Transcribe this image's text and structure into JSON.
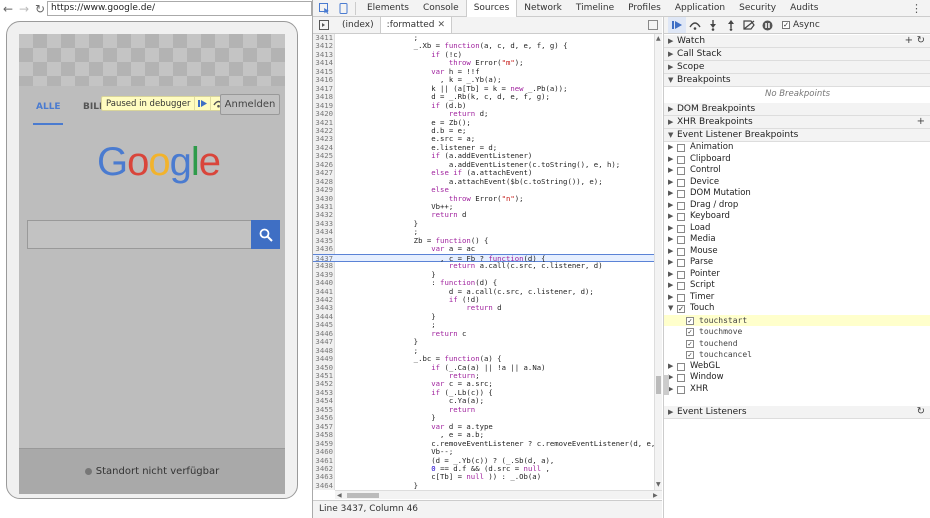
{
  "browser": {
    "url": "https://www.google.de/"
  },
  "device": {
    "tab_alle": "ALLE",
    "tab_bild": "BILD",
    "debug_banner": "Paused in debugger",
    "anmelden": "Anmelden",
    "logo_letters": [
      "G",
      "o",
      "o",
      "g",
      "l",
      "e"
    ],
    "logo_colors": [
      "#4a7bd0",
      "#d9453b",
      "#f2b32c",
      "#4a7bd0",
      "#2e9b4a",
      "#d9453b"
    ],
    "footer_status": "Standort nicht verfügbar"
  },
  "devtools": {
    "tabs": [
      "Elements",
      "Console",
      "Sources",
      "Network",
      "Timeline",
      "Profiles",
      "Application",
      "Security",
      "Audits"
    ],
    "active_tab": "Sources",
    "source_tabs": [
      "(index)",
      ":formatted"
    ],
    "status_bar": "Line 3437, Column 46",
    "code_lines": [
      {
        "n": "3411",
        "t": "                 ;"
      },
      {
        "n": "3412",
        "t": "                 _.Xb = function(a, c, d, e, f, g) {"
      },
      {
        "n": "3413",
        "t": "                     if (!c)"
      },
      {
        "n": "3414",
        "t": "                         throw Error(\"m\");"
      },
      {
        "n": "3415",
        "t": "                     var h = !!f"
      },
      {
        "n": "3416",
        "t": "                       , k = _.Yb(a);"
      },
      {
        "n": "3417",
        "t": "                     k || (a[Tb] = k = new _.Pb(a));"
      },
      {
        "n": "3418",
        "t": "                     d = _.Rb(k, c, d, e, f, g);"
      },
      {
        "n": "3419",
        "t": "                     if (d.b)"
      },
      {
        "n": "3420",
        "t": "                         return d;"
      },
      {
        "n": "3421",
        "t": "                     e = Zb();"
      },
      {
        "n": "3422",
        "t": "                     d.b = e;"
      },
      {
        "n": "3423",
        "t": "                     e.src = a;"
      },
      {
        "n": "3424",
        "t": "                     e.listener = d;"
      },
      {
        "n": "3425",
        "t": "                     if (a.addEventListener)"
      },
      {
        "n": "3426",
        "t": "                         a.addEventListener(c.toString(), e, h);"
      },
      {
        "n": "3427",
        "t": "                     else if (a.attachEvent)"
      },
      {
        "n": "3428",
        "t": "                         a.attachEvent($b(c.toString()), e);"
      },
      {
        "n": "3429",
        "t": "                     else"
      },
      {
        "n": "3430",
        "t": "                         throw Error(\"n\");"
      },
      {
        "n": "3431",
        "t": "                     Vb++;"
      },
      {
        "n": "3432",
        "t": "                     return d"
      },
      {
        "n": "3433",
        "t": "                 }"
      },
      {
        "n": "3434",
        "t": "                 ;"
      },
      {
        "n": "3435",
        "t": "                 Zb = function() {"
      },
      {
        "n": "3436",
        "t": "                     var a = ac"
      },
      {
        "n": "3437",
        "t": "                       , c = Fb ? function(d) {"
      },
      {
        "n": "3438",
        "t": "                         return a.call(c.src, c.listener, d)"
      },
      {
        "n": "3439",
        "t": "                     }"
      },
      {
        "n": "3440",
        "t": "                     : function(d) {"
      },
      {
        "n": "3441",
        "t": "                         d = a.call(c.src, c.listener, d);"
      },
      {
        "n": "3442",
        "t": "                         if (!d)"
      },
      {
        "n": "3443",
        "t": "                             return d"
      },
      {
        "n": "3444",
        "t": "                     }"
      },
      {
        "n": "3445",
        "t": "                     ;"
      },
      {
        "n": "3446",
        "t": "                     return c"
      },
      {
        "n": "3447",
        "t": "                 }"
      },
      {
        "n": "3448",
        "t": "                 ;"
      },
      {
        "n": "3449",
        "t": "                 _.bc = function(a) {"
      },
      {
        "n": "3450",
        "t": "                     if (_.Ca(a) || !a || a.Na)"
      },
      {
        "n": "3451",
        "t": "                         return;"
      },
      {
        "n": "3452",
        "t": "                     var c = a.src;"
      },
      {
        "n": "3453",
        "t": "                     if (_.Lb(c)) {"
      },
      {
        "n": "3454",
        "t": "                         c.Ya(a);"
      },
      {
        "n": "3455",
        "t": "                         return"
      },
      {
        "n": "3456",
        "t": "                     }"
      },
      {
        "n": "3457",
        "t": "                     var d = a.type"
      },
      {
        "n": "3458",
        "t": "                       , e = a.b;"
      },
      {
        "n": "3459",
        "t": "                     c.removeEventListener ? c.removeEventListener(d, e, a.Xa)"
      },
      {
        "n": "3460",
        "t": "                     Vb--;"
      },
      {
        "n": "3461",
        "t": "                     (d = _.Yb(c)) ? (_.Sb(d, a),"
      },
      {
        "n": "3462",
        "t": "                     0 == d.f && (d.src = null ,"
      },
      {
        "n": "3463",
        "t": "                     c[Tb] = null )) : _.Ob(a)"
      },
      {
        "n": "3464",
        "t": "                 }"
      },
      {
        "n": "3465",
        "t": "                 ;"
      }
    ],
    "highlight_line": "3437",
    "sidebar": {
      "async_label": "Async",
      "watch": "Watch",
      "call_stack": "Call Stack",
      "scope": "Scope",
      "breakpoints": "Breakpoints",
      "no_breakpoints": "No Breakpoints",
      "dom_breakpoints": "DOM Breakpoints",
      "xhr_breakpoints": "XHR Breakpoints",
      "event_listener_breakpoints": "Event Listener Breakpoints",
      "event_categories": [
        "Animation",
        "Clipboard",
        "Control",
        "Device",
        "DOM Mutation",
        "Drag / drop",
        "Keyboard",
        "Load",
        "Media",
        "Mouse",
        "Parse",
        "Pointer",
        "Script",
        "Timer",
        "Touch"
      ],
      "touch_events": [
        "touchstart",
        "touchmove",
        "touchend",
        "touchcancel"
      ],
      "more_categories": [
        "WebGL",
        "Window",
        "XHR"
      ],
      "event_listeners": "Event Listeners"
    }
  }
}
